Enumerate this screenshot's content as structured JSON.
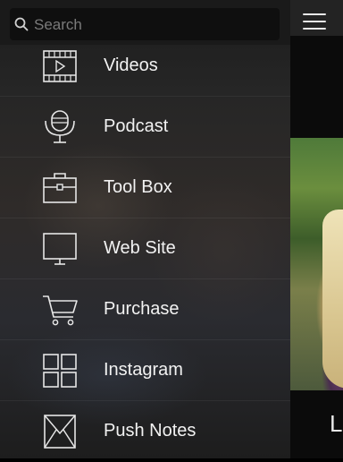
{
  "search": {
    "placeholder": "Search"
  },
  "menu": {
    "items": [
      {
        "label": "Videos",
        "icon": "film-icon"
      },
      {
        "label": "Podcast",
        "icon": "microphone-icon"
      },
      {
        "label": "Tool Box",
        "icon": "toolbox-icon"
      },
      {
        "label": "Web Site",
        "icon": "monitor-icon"
      },
      {
        "label": "Purchase",
        "icon": "cart-icon"
      },
      {
        "label": "Instagram",
        "icon": "grid-icon"
      },
      {
        "label": "Push Notes",
        "icon": "envelope-icon"
      }
    ]
  },
  "content": {
    "bottom_text": "L"
  },
  "colors": {
    "menu_bg": "#262626",
    "search_bg": "#0f0f0f",
    "text": "#f2f2f2"
  }
}
